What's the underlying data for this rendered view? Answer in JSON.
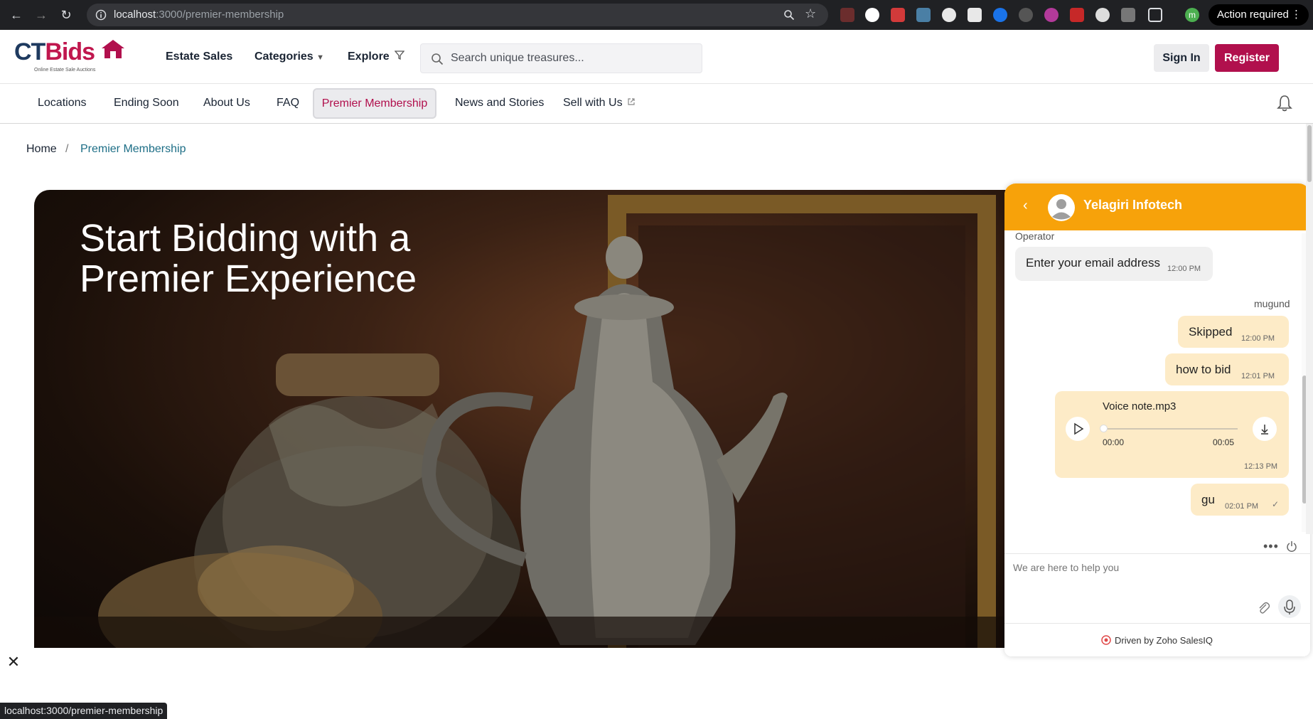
{
  "browser": {
    "url_host": "localhost",
    "url_path": ":3000/premier-membership",
    "profile_initial": "m",
    "action_required": "Action required",
    "status_url": "localhost:3000/premier-membership"
  },
  "header": {
    "logo_ct": "CT",
    "logo_bids": "Bids",
    "logo_tagline": "Online Estate Sale Auctions",
    "nav": [
      "Estate Sales",
      "Categories",
      "Explore"
    ],
    "search_placeholder": "Search unique treasures...",
    "sign_in": "Sign In",
    "register": "Register"
  },
  "subnav": {
    "items": [
      "Locations",
      "Ending Soon",
      "About Us",
      "FAQ",
      "Premier Membership",
      "News and Stories",
      "Sell with Us"
    ]
  },
  "breadcrumb": {
    "home": "Home",
    "separator": "/",
    "current": "Premier Membership"
  },
  "hero": {
    "title": "Start Bidding with a Premier Experience"
  },
  "chat": {
    "company": "Yelagiri Infotech",
    "operator_label": "Operator",
    "operator_msg": "Enter your email address",
    "operator_time": "12:00 PM",
    "user_name": "mugund",
    "messages": [
      {
        "text": "Skipped",
        "time": "12:00 PM"
      },
      {
        "text": "how to bid",
        "time": "12:01 PM"
      }
    ],
    "voice": {
      "name": "Voice note.mp3",
      "start": "00:00",
      "end": "00:05",
      "time": "12:13 PM"
    },
    "last_msg": {
      "text": "gu",
      "time": "02:01 PM"
    },
    "input_placeholder": "We are here to help you",
    "driven_by": "Driven by Zoho SalesIQ"
  },
  "colors": {
    "brand": "#b1104d",
    "chat_header": "#f7a20a",
    "user_bubble": "#fdebc7"
  }
}
